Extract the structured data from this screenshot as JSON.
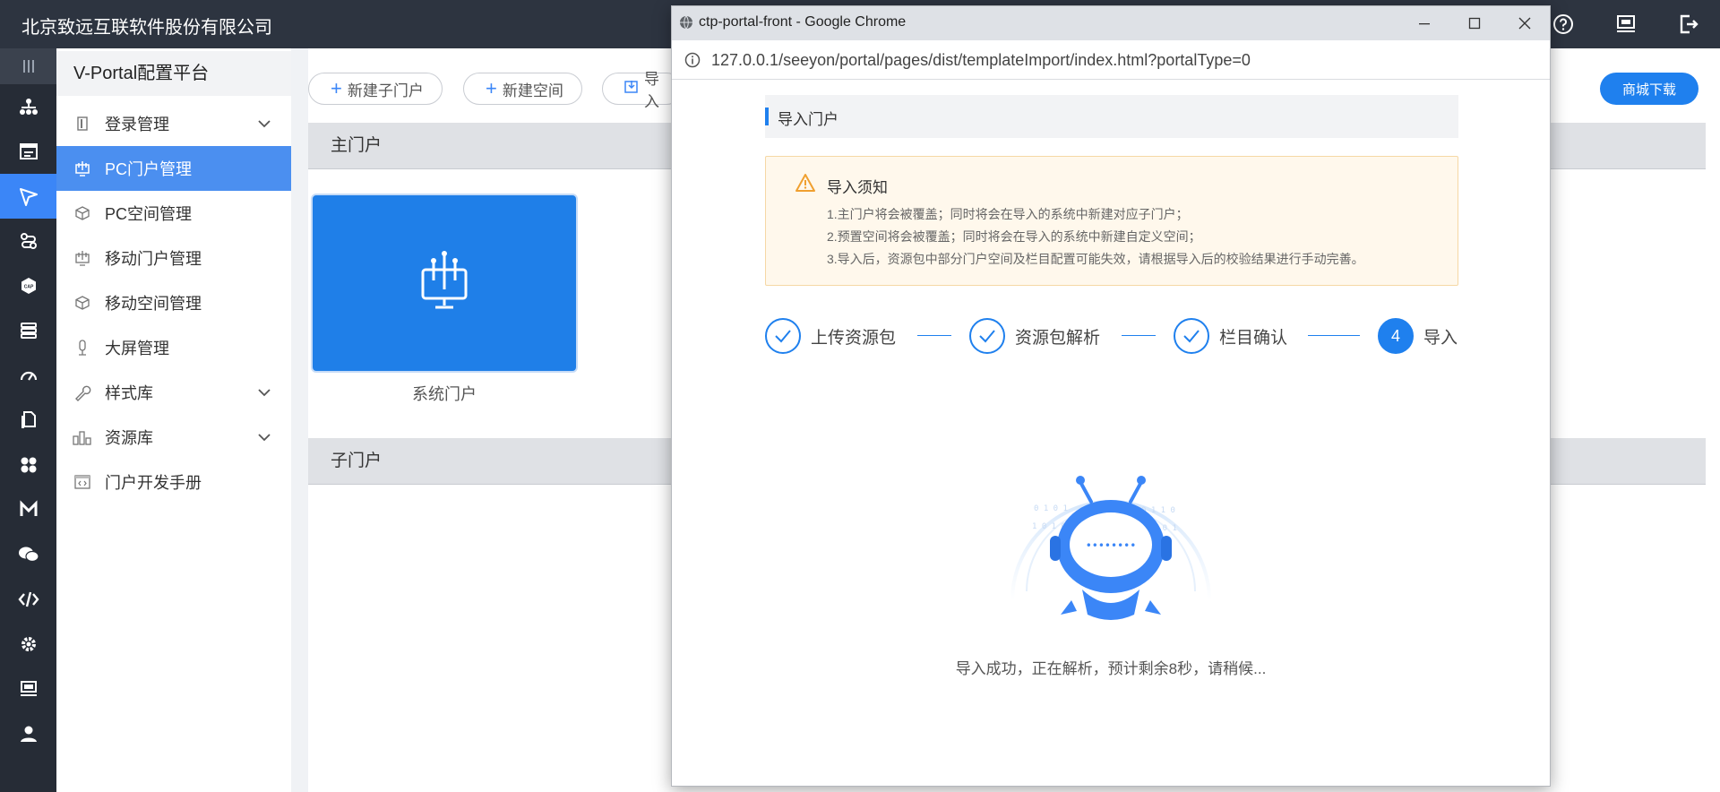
{
  "topbar": {
    "company": "北京致远互联软件股份有限公司",
    "icons": [
      "help-icon",
      "monitor-icon",
      "logout-icon"
    ]
  },
  "rail": {
    "icons": [
      "menu-lines-icon",
      "org-chart-icon",
      "table-icon",
      "send-icon",
      "flow-icon",
      "cap-icon",
      "stack-icon",
      "gauge-icon",
      "document-icon",
      "grid-apps-icon",
      "m-icon",
      "wechat-icon",
      "code-icon",
      "gear-icon",
      "screen-icon",
      "user-icon"
    ],
    "active_index": 3
  },
  "sidebar": {
    "title": "V-Portal配置平台",
    "items": [
      {
        "label": "登录管理",
        "icon": "login-icon",
        "expandable": true
      },
      {
        "label": "PC门户管理",
        "icon": "pc-portal-icon",
        "active": true
      },
      {
        "label": "PC空间管理",
        "icon": "cube-icon"
      },
      {
        "label": "移动门户管理",
        "icon": "mobile-portal-icon"
      },
      {
        "label": "移动空间管理",
        "icon": "cube-icon"
      },
      {
        "label": "大屏管理",
        "icon": "bigscreen-icon"
      },
      {
        "label": "样式库",
        "icon": "wrench-icon",
        "expandable": true
      },
      {
        "label": "资源库",
        "icon": "chart-icon",
        "expandable": true
      },
      {
        "label": "门户开发手册",
        "icon": "code-book-icon"
      }
    ]
  },
  "main": {
    "buttons": {
      "new_sub_portal": "新建子门户",
      "new_space": "新建空间",
      "import": "导入",
      "mall_download": "商城下载"
    },
    "sections": {
      "main_portal": "主门户",
      "sub_portal": "子门户"
    },
    "card_caption": "系统门户"
  },
  "popup": {
    "window_title": "ctp-portal-front - Google Chrome",
    "url": "127.0.0.1/seeyon/portal/pages/dist/templateImport/index.html?portalType=0",
    "header": "导入门户",
    "notice": {
      "title": "导入须知",
      "lines": [
        "1.主门户将会被覆盖；同时将会在导入的系统中新建对应子门户；",
        "2.预置空间将会被覆盖；同时将会在导入的系统中新建自定义空间；",
        "3.导入后，资源包中部分门户空间及栏目配置可能失效，请根据导入后的校验结果进行手动完善。"
      ]
    },
    "steps": [
      {
        "label": "上传资源包",
        "state": "done"
      },
      {
        "label": "资源包解析",
        "state": "done"
      },
      {
        "label": "栏目确认",
        "state": "done"
      },
      {
        "label": "导入",
        "state": "current",
        "number": "4"
      }
    ],
    "status": "导入成功，正在解析，预计剩余8秒，请稍候..."
  },
  "colors": {
    "primary": "#1f80ee",
    "topbar": "#2d3440",
    "rail": "#262c36",
    "active_menu": "#4b8ff0",
    "notice_bg": "#fff8ec"
  }
}
